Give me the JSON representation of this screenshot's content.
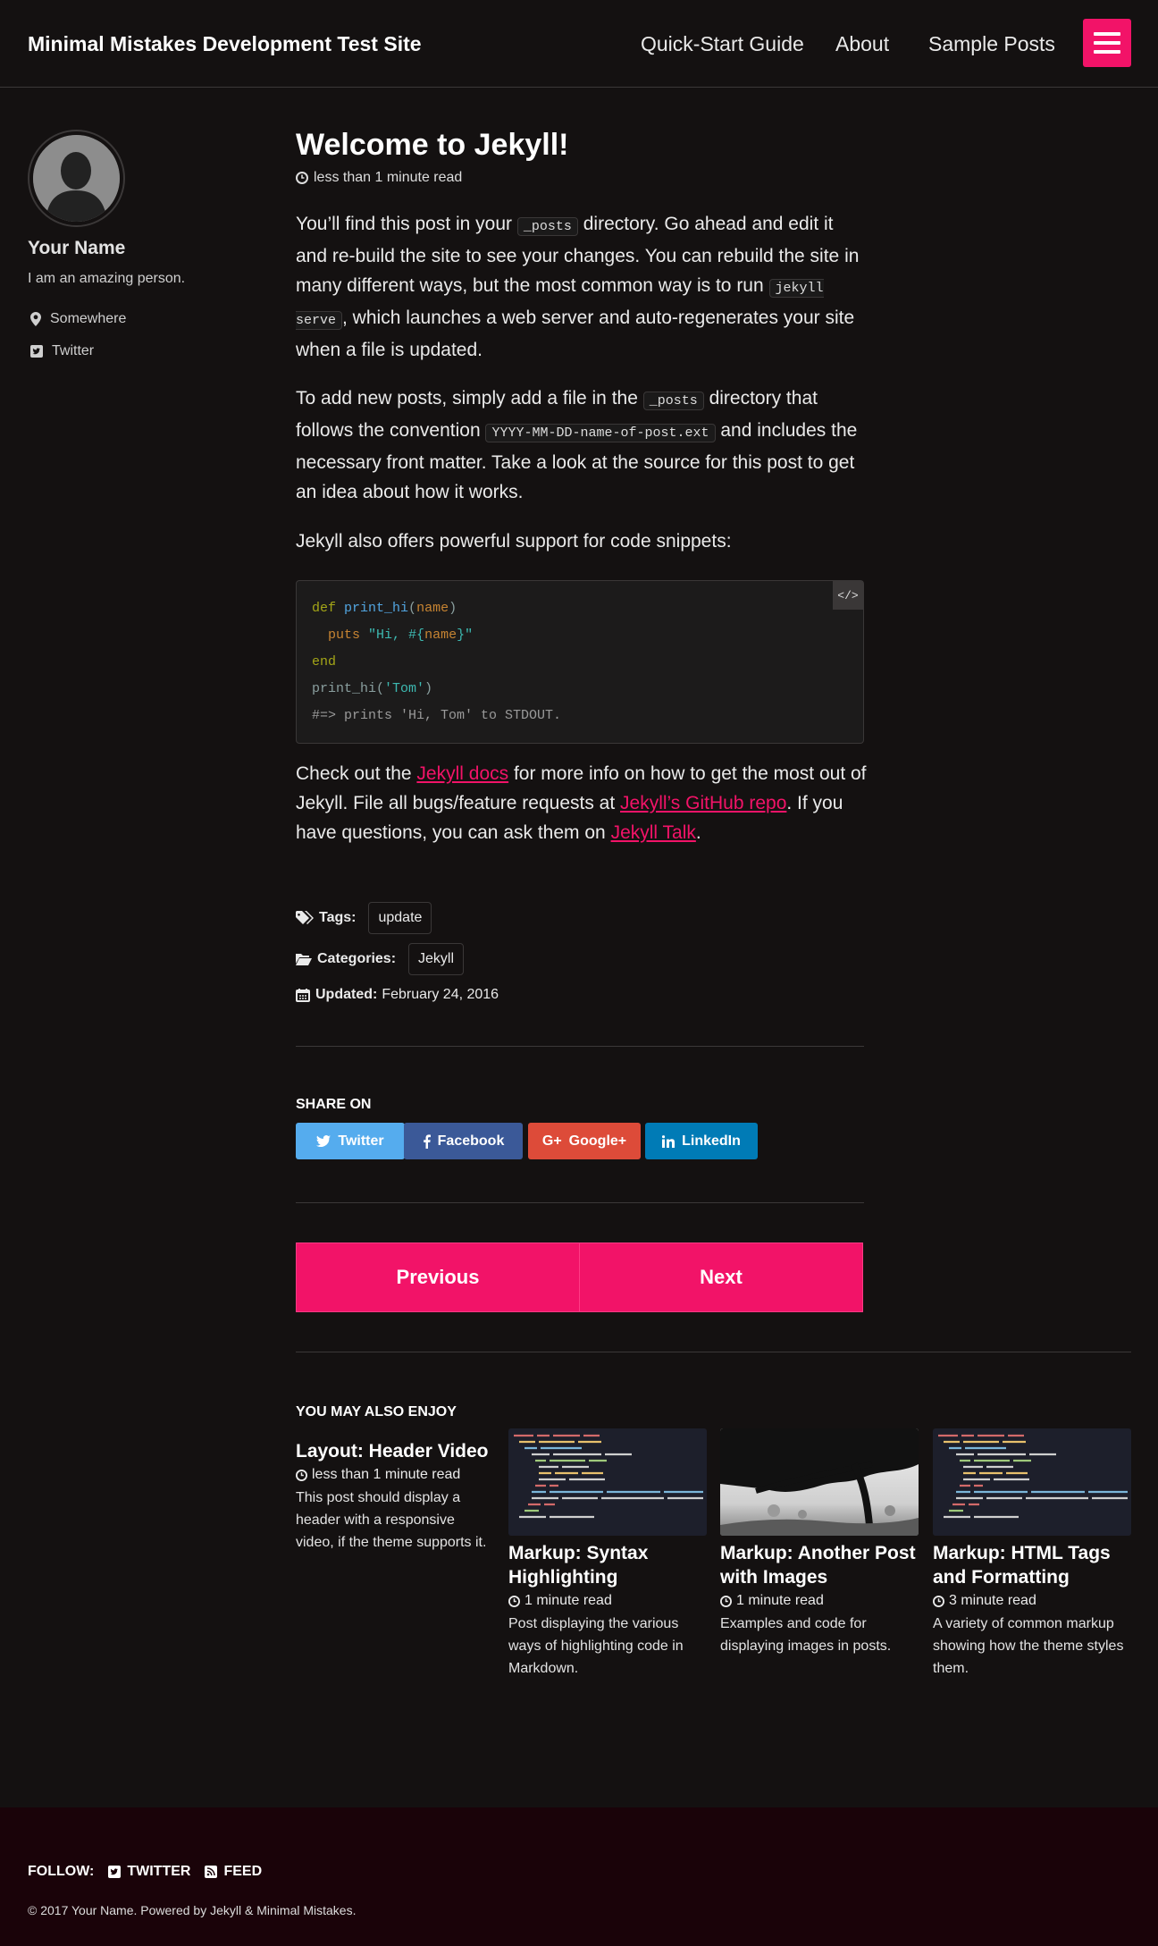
{
  "header": {
    "site_title": "Minimal Mistakes Development Test Site",
    "nav": [
      "Quick-Start Guide",
      "About",
      "Sample Posts"
    ],
    "accent": "#f21368"
  },
  "author": {
    "name": "Your Name",
    "bio": "I am an amazing person.",
    "links": [
      {
        "icon": "map-marker-icon",
        "label": "Somewhere"
      },
      {
        "icon": "twitter-square-icon",
        "label": "Twitter"
      }
    ]
  },
  "post": {
    "title": "Welcome to Jekyll!",
    "read_time": "less than 1 minute read",
    "p1": {
      "a": "You’ll find this post in your ",
      "code1": "_posts",
      "b": " directory. Go ahead and edit it and re-build the site to see your changes. You can rebuild the site in many different ways, but the most common way is to run ",
      "code2": "jekyll serve",
      "c": ", which launches a web server and auto-regenerates your site when a file is updated."
    },
    "p2": {
      "a": "To add new posts, simply add a file in the ",
      "code1": "_posts",
      "b": " directory that follows the convention ",
      "code2": "YYYY-MM-DD-name-of-post.ext",
      "c": " and includes the necessary front matter. Take a look at the source for this post to get an idea about how it works."
    },
    "p3": "Jekyll also offers powerful support for code snippets:",
    "code": {
      "copy_label": "</>",
      "l1_def": "def",
      "l1_fn": "print_hi",
      "l1_open": "(",
      "l1_arg": "name",
      "l1_close": ")",
      "l2_puts": "puts",
      "l2_str1": "\"Hi, #{",
      "l2_var": "name",
      "l2_str2": "}\"",
      "l3_end": "end",
      "l4_call": "print_hi(",
      "l4_str": "'Tom'",
      "l4_close": ")",
      "l5_comment": "#=> prints 'Hi, Tom' to STDOUT."
    },
    "p4": {
      "a": "Check out the ",
      "link1": "Jekyll docs",
      "b": " for more info on how to get the most out of Jekyll. File all bugs/feature requests at ",
      "link2": "Jekyll’s GitHub repo",
      "c": ". If you have questions, you can ask them on ",
      "link3": "Jekyll Talk",
      "d": "."
    },
    "tags_label": "Tags:",
    "tag": "update",
    "categories_label": "Categories:",
    "category": "Jekyll",
    "updated_label": "Updated:",
    "updated": "February 24, 2016"
  },
  "share": {
    "title": "SHARE ON",
    "buttons": [
      {
        "label": "Twitter",
        "icon": "twitter-icon",
        "color": "#55acee"
      },
      {
        "label": "Facebook",
        "icon": "facebook-icon",
        "color": "#3b5998"
      },
      {
        "label": "Google+",
        "icon": "google-plus-icon",
        "color": "#dd4b39"
      },
      {
        "label": "LinkedIn",
        "icon": "linkedin-icon",
        "color": "#007bb6"
      }
    ]
  },
  "pager": {
    "previous": "Previous",
    "next": "Next"
  },
  "related": {
    "title": "YOU MAY ALSO ENJOY",
    "items": [
      {
        "title": "Layout: Header Video",
        "read_time": "less than 1 minute read",
        "excerpt": "This post should display a header with a responsive video, if the theme supports it."
      },
      {
        "title": "Markup: Syntax Highlighting",
        "read_time": "1 minute read",
        "excerpt": "Post displaying the various ways of highlighting code in Markdown."
      },
      {
        "title": "Markup: Another Post with Images",
        "read_time": "1 minute read",
        "excerpt": "Examples and code for displaying images in posts."
      },
      {
        "title": "Markup: HTML Tags and Formatting",
        "read_time": "3 minute read",
        "excerpt": "A variety of common markup showing how the theme styles them."
      }
    ]
  },
  "footer": {
    "follow_label": "FOLLOW:",
    "twitter": "TWITTER",
    "feed": "FEED",
    "copyright": "© 2017 Your Name. Powered by Jekyll & Minimal Mistakes."
  }
}
